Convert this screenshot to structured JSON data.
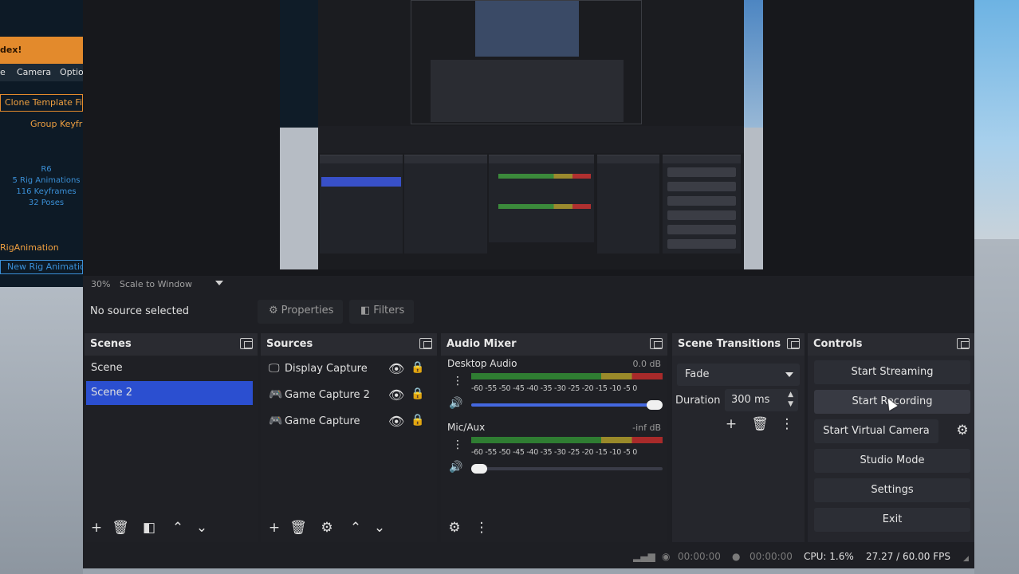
{
  "left_app": {
    "title": "dex!",
    "tabs": [
      "e",
      "Camera",
      "Optio"
    ],
    "clone_template": "Clone Template Fil",
    "group_keyframes": "Group Keyfra",
    "rig_label": "R6",
    "rig_stats": [
      "5 Rig Animations",
      "116 Keyframes",
      "32 Poses"
    ],
    "rig_animation": "RigAnimation",
    "new_rig_animation": "New Rig Animatio"
  },
  "preview_bar": {
    "zoom": "30%",
    "scale_mode": "Scale to Window"
  },
  "source_bar": {
    "no_source": "No source selected",
    "properties_label": "Properties",
    "filters_label": "Filters"
  },
  "scenes": {
    "title": "Scenes",
    "items": [
      {
        "label": "Scene",
        "selected": false
      },
      {
        "label": "Scene 2",
        "selected": true
      }
    ]
  },
  "sources": {
    "title": "Sources",
    "items": [
      {
        "label": "Display Capture",
        "icon": "monitor-icon"
      },
      {
        "label": "Game Capture 2",
        "icon": "gamepad-icon"
      },
      {
        "label": "Game Capture",
        "icon": "gamepad-icon"
      }
    ]
  },
  "audio_mixer": {
    "title": "Audio Mixer",
    "ticks": "-60 -55 -50 -45 -40 -35 -30 -25 -20 -15 -10 -5 0",
    "channels": [
      {
        "name": "Desktop Audio",
        "db": "0.0 dB",
        "volume": 1.0
      },
      {
        "name": "Mic/Aux",
        "db": "-inf dB",
        "volume": 0.0
      }
    ]
  },
  "scene_transitions": {
    "title": "Scene Transitions",
    "transition": "Fade",
    "duration_label": "Duration",
    "duration_value": "300 ms"
  },
  "controls": {
    "title": "Controls",
    "start_streaming": "Start Streaming",
    "start_recording": "Start Recording",
    "start_virtual_camera": "Start Virtual Camera",
    "studio_mode": "Studio Mode",
    "settings": "Settings",
    "exit": "Exit"
  },
  "status_bar": {
    "stream_time": "00:00:00",
    "record_time": "00:00:00",
    "cpu": "CPU: 1.6%",
    "fps": "27.27 / 60.00 FPS"
  },
  "colors": {
    "selection_blue": "#2b4fd0",
    "window_bg": "#1e1f24",
    "accent_orange": "#e38a2c"
  }
}
